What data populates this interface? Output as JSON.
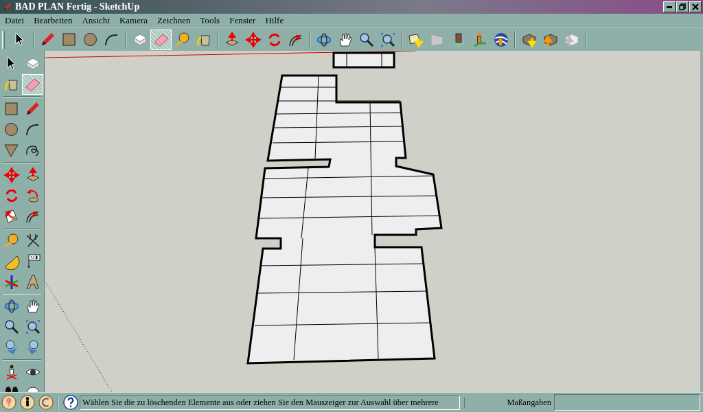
{
  "window": {
    "title": "BAD PLAN Fertig - SketchUp"
  },
  "menu": [
    "Datei",
    "Bearbeiten",
    "Ansicht",
    "Kamera",
    "Zeichnen",
    "Tools",
    "Fenster",
    "Hilfe"
  ],
  "toolbar": [
    [
      {
        "selected": false
      }
    ],
    [
      {
        "selected": false
      },
      {
        "selected": false
      },
      {
        "selected": false
      },
      {
        "selected": false
      }
    ],
    [
      {
        "selected": false
      },
      {
        "selected": true
      },
      {
        "selected": false
      },
      {
        "selected": false
      }
    ],
    [
      {
        "selected": false
      },
      {
        "selected": false
      },
      {
        "selected": false
      },
      {
        "selected": false
      }
    ],
    [
      {
        "selected": false
      },
      {
        "selected": false
      },
      {
        "selected": false
      },
      {
        "selected": false
      }
    ],
    [
      {
        "selected": false
      },
      {
        "selected": false
      },
      {
        "selected": false
      },
      {
        "selected": false
      },
      {
        "selected": false
      }
    ],
    [
      {
        "selected": false
      },
      {
        "selected": false
      },
      {
        "selected": false
      }
    ]
  ],
  "side_toolbar": [
    [
      {
        "selected": false
      },
      {
        "selected": false
      },
      {
        "selected": false
      },
      {
        "selected": true
      }
    ],
    [
      {
        "selected": false
      },
      {
        "selected": false
      },
      {
        "selected": false
      },
      {
        "selected": false
      },
      {
        "selected": false
      },
      {
        "selected": false
      }
    ],
    [
      {
        "selected": false
      },
      {
        "selected": false
      },
      {
        "selected": false
      },
      {
        "selected": false
      },
      {
        "selected": false
      },
      {
        "selected": false
      }
    ],
    [
      {
        "selected": false
      },
      {
        "selected": false
      },
      {
        "selected": false
      },
      {
        "selected": false
      },
      {
        "selected": false
      },
      {
        "selected": false
      }
    ],
    [
      {
        "selected": false
      },
      {
        "selected": false
      },
      {
        "selected": false
      },
      {
        "selected": false
      },
      {
        "selected": false
      },
      {
        "selected": false
      }
    ],
    [
      {
        "selected": false
      },
      {
        "selected": false
      }
    ]
  ],
  "status_bar": {
    "message": "Wählen Sie die zu löschenden Elemente aus oder ziehen Sie den Mauszeiger zur Auswahl über mehrere",
    "measurements_label": "Maßangaben"
  }
}
